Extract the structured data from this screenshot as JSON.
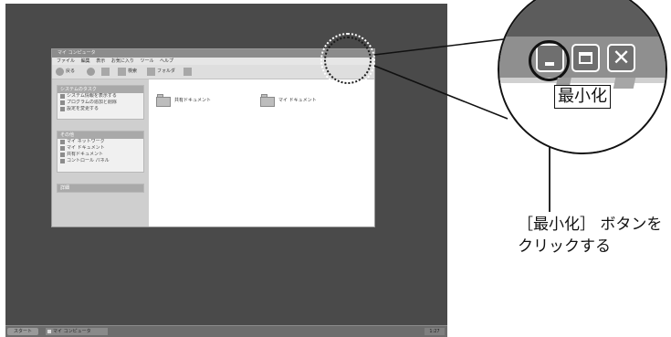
{
  "desktop": {
    "taskbar": {
      "start_label": "スタート",
      "task_item_label": "マイ コンピュータ",
      "tray_time": "1:27"
    }
  },
  "explorer_window": {
    "title": "マイ コンピュータ",
    "menu": [
      "ファイル",
      "編集",
      "表示",
      "お気に入り",
      "ツール",
      "ヘルプ"
    ],
    "toolbar": {
      "back_label": "戻る",
      "search_label": "検索",
      "folders_label": "フォルダ"
    },
    "sidebar": {
      "panels": [
        {
          "title": "システムのタスク",
          "items": [
            "システム情報を表示する",
            "プログラムの追加と削除",
            "設定を変更する"
          ]
        },
        {
          "title": "その他",
          "items": [
            "マイ ネットワーク",
            "マイ ドキュメント",
            "共有ドキュメント",
            "コントロール パネル"
          ]
        },
        {
          "title": "詳細",
          "items": []
        }
      ]
    },
    "folders": [
      "共有ドキュメント",
      "マイ ドキュメント"
    ]
  },
  "magnified": {
    "tooltip": "最小化"
  },
  "caption": {
    "line1": "［最小化］ ボタンを",
    "line2": "クリックする"
  }
}
